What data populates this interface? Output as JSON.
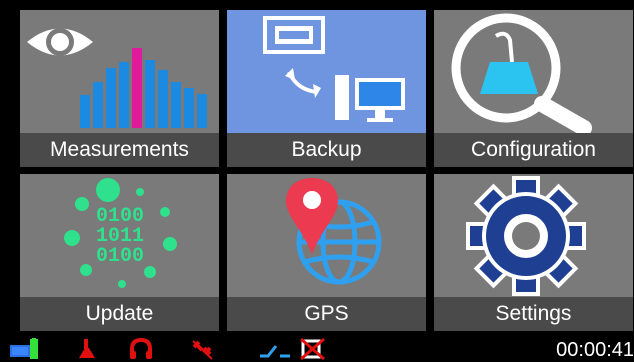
{
  "header": {
    "title": ""
  },
  "tiles": [
    {
      "id": "measurements",
      "label": "Measurements",
      "active": false
    },
    {
      "id": "backup",
      "label": "Backup",
      "active": true
    },
    {
      "id": "configuration",
      "label": "Configuration",
      "active": false
    },
    {
      "id": "update",
      "label": "Update",
      "active": false
    },
    {
      "id": "gps",
      "label": "GPS",
      "active": false
    },
    {
      "id": "settings",
      "label": "Settings",
      "active": false
    }
  ],
  "update_tile": {
    "binary": [
      "0100",
      "1011",
      "0100"
    ]
  },
  "status": {
    "clock": "00:00:41",
    "icons": [
      "battery-icon",
      "fill-level-icon",
      "headphones-icon",
      "gps-off-icon",
      "switch-icon",
      "no-connection-icon"
    ]
  },
  "colors": {
    "tile": "#7a7a7a",
    "tile_active": "#6f94e0",
    "label_bar": "#4a4a4a",
    "accent_red": "#e01010"
  }
}
